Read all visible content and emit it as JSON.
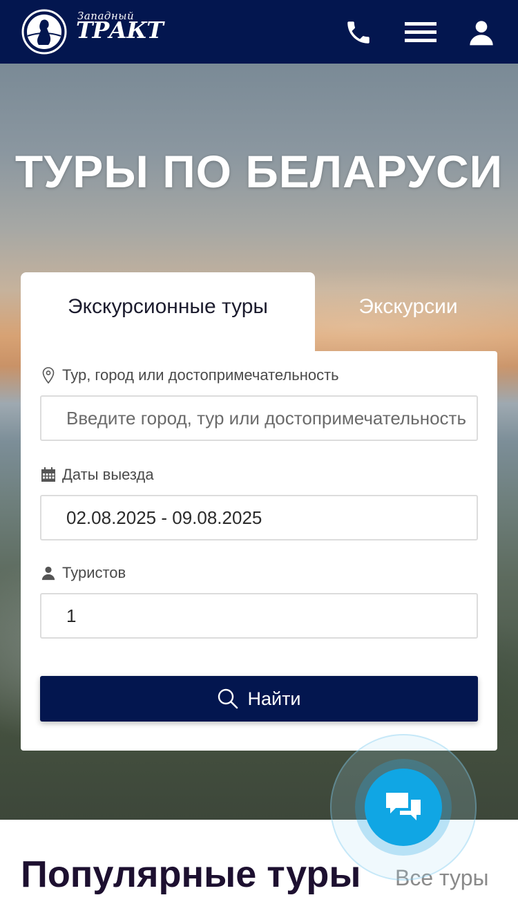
{
  "header": {
    "logo_small": "Западный",
    "logo_big": "ТРАКТ",
    "icons": [
      "phone-icon",
      "menu-icon",
      "user-icon"
    ]
  },
  "hero": {
    "title": "ТУРЫ ПО БЕЛАРУСИ"
  },
  "tabs": [
    {
      "label": "Экскурсионные туры",
      "active": true
    },
    {
      "label": "Экскурсии",
      "active": false
    }
  ],
  "form": {
    "destination": {
      "label": "Тур, город или достопримечательность",
      "placeholder": "Введите город, тур или достопримечательность",
      "icon": "map-pin-icon"
    },
    "dates": {
      "label": "Даты выезда",
      "value": "02.08.2025 - 09.08.2025",
      "icon": "calendar-icon"
    },
    "tourists": {
      "label": "Туристов",
      "value": "1",
      "icon": "person-icon"
    },
    "search_button": "Найти"
  },
  "popular": {
    "title": "Популярные туры",
    "all_link": "Все туры"
  },
  "colors": {
    "header_bg": "#03164f",
    "button_bg": "#03164f",
    "chat_bg": "#10a6e4"
  }
}
